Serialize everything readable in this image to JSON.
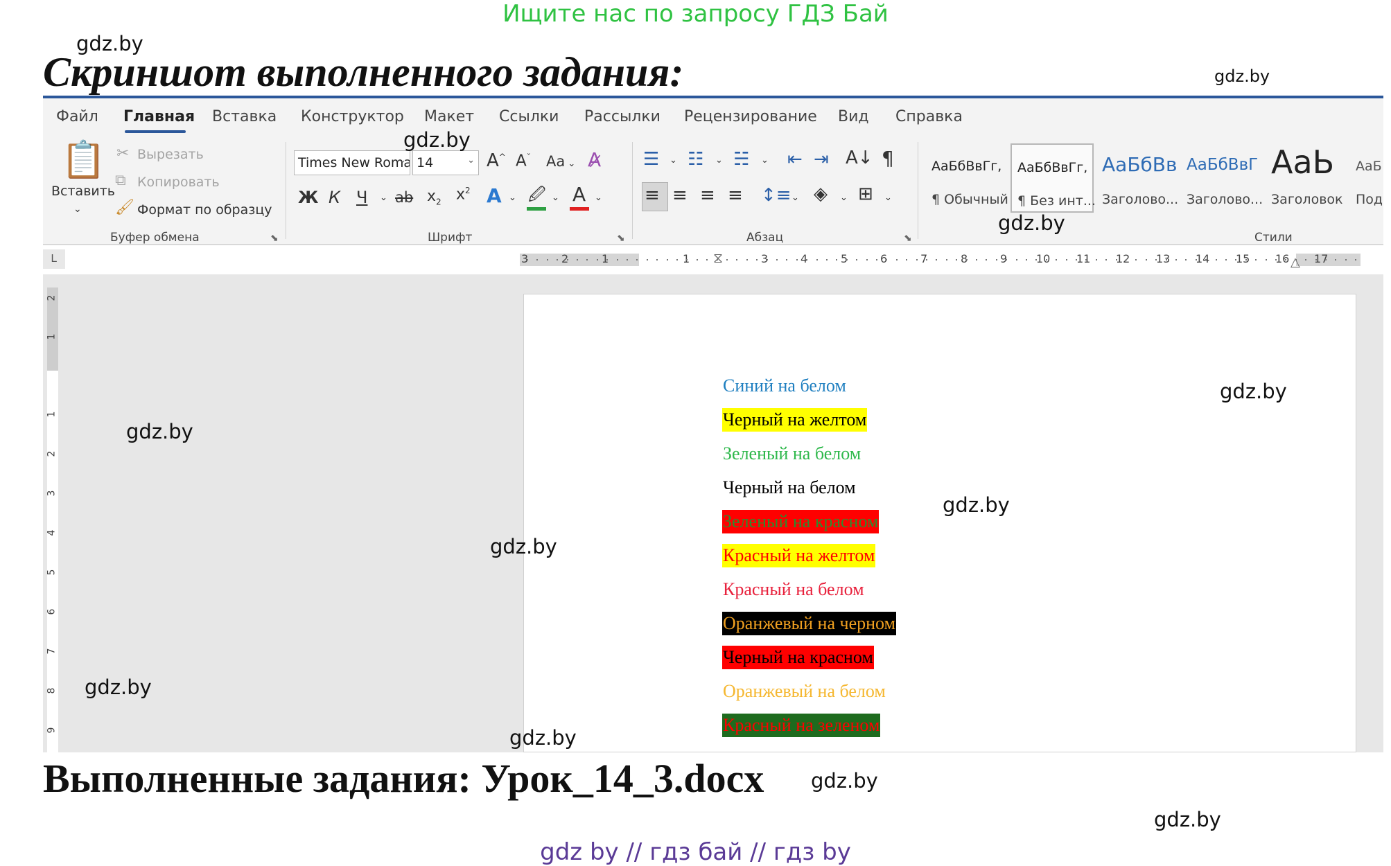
{
  "banner": "Ищите нас по запросу ГДЗ Бай",
  "heading": "Скриншот выполненного задания:",
  "watermarks": [
    "gdz.by",
    "gdz.by",
    "gdz.by",
    "gdz.by",
    "gdz.by",
    "gdz.by",
    "gdz.by",
    "gdz.by",
    "gdz.by",
    "gdz.by",
    "gdz.by",
    "gdz.by"
  ],
  "ribbon": {
    "tabs": [
      "Файл",
      "Главная",
      "Вставка",
      "Конструктор",
      "Макет",
      "Ссылки",
      "Рассылки",
      "Рецензирование",
      "Вид",
      "Справка"
    ],
    "active_tab": "Главная",
    "clipboard": {
      "paste": "Вставить",
      "cut": "Вырезать",
      "copy": "Копировать",
      "format_painter": "Формат по образцу",
      "group": "Буфер обмена"
    },
    "font": {
      "name": "Times New Roman",
      "size": "14",
      "bold": "Ж",
      "italic": "К",
      "underline": "Ч",
      "strike": "ab",
      "change_case": "Aa",
      "group": "Шрифт",
      "highlight_color": "#2ea043",
      "font_color": "#e02020"
    },
    "paragraph": {
      "group": "Абзац"
    },
    "styles": {
      "group": "Стили",
      "items": [
        {
          "sample": "АаБбВвГг,",
          "name": "¶ Обычный"
        },
        {
          "sample": "АаБбВвГг,",
          "name": "¶ Без инт..."
        },
        {
          "sample": "АаБбВв",
          "name": "Заголово..."
        },
        {
          "sample": "АаБбВвГ",
          "name": "Заголово..."
        },
        {
          "sample": "АаЬ",
          "name": "Заголовок"
        },
        {
          "sample": "АаБ",
          "name": "Подз"
        }
      ]
    }
  },
  "ruler": {
    "h_numbers": [
      "3",
      "2",
      "1",
      "1",
      "3",
      "4",
      "5",
      "6",
      "7",
      "8",
      "9",
      "10",
      "11",
      "12",
      "13",
      "14",
      "15",
      "16",
      "17"
    ],
    "v_numbers": [
      "2",
      "1",
      "1",
      "2",
      "3",
      "4",
      "5",
      "6",
      "7",
      "8",
      "9"
    ],
    "corner": "L"
  },
  "document": {
    "lines": [
      {
        "text": "Синий на белом",
        "color": "#1f7fc0",
        "bg": "#ffffff"
      },
      {
        "text": "Черный на желтом",
        "color": "#000000",
        "bg": "#ffff00"
      },
      {
        "text": "Зеленый на белом",
        "color": "#2eb84b",
        "bg": "#ffffff"
      },
      {
        "text": "Черный на белом",
        "color": "#000000",
        "bg": "#ffffff"
      },
      {
        "text": "Зеленый на красном",
        "color": "#2e8b2e",
        "bg": "#ff0000"
      },
      {
        "text": "Красный на желтом",
        "color": "#ff0000",
        "bg": "#ffff00"
      },
      {
        "text": "Красный на белом",
        "color": "#e8213c",
        "bg": "#ffffff"
      },
      {
        "text": "Оранжевый на черном",
        "color": "#f0a020",
        "bg": "#000000"
      },
      {
        "text": "Черный на красном",
        "color": "#000000",
        "bg": "#ff0000"
      },
      {
        "text": "Оранжевый на белом",
        "color": "#f5b730",
        "bg": "#ffffff"
      },
      {
        "text": "Красный на зеленом",
        "color": "#ff0000",
        "bg": "#1e6b1e"
      }
    ]
  },
  "footer_title": "Выполненные задания: Урок_14_3.docx",
  "bottom_links": "gdz by  //  гдз бай  //  гдз by",
  "colors": {
    "accent": "#2b579a",
    "banner": "#2fc242",
    "links": "#5a3a96"
  }
}
